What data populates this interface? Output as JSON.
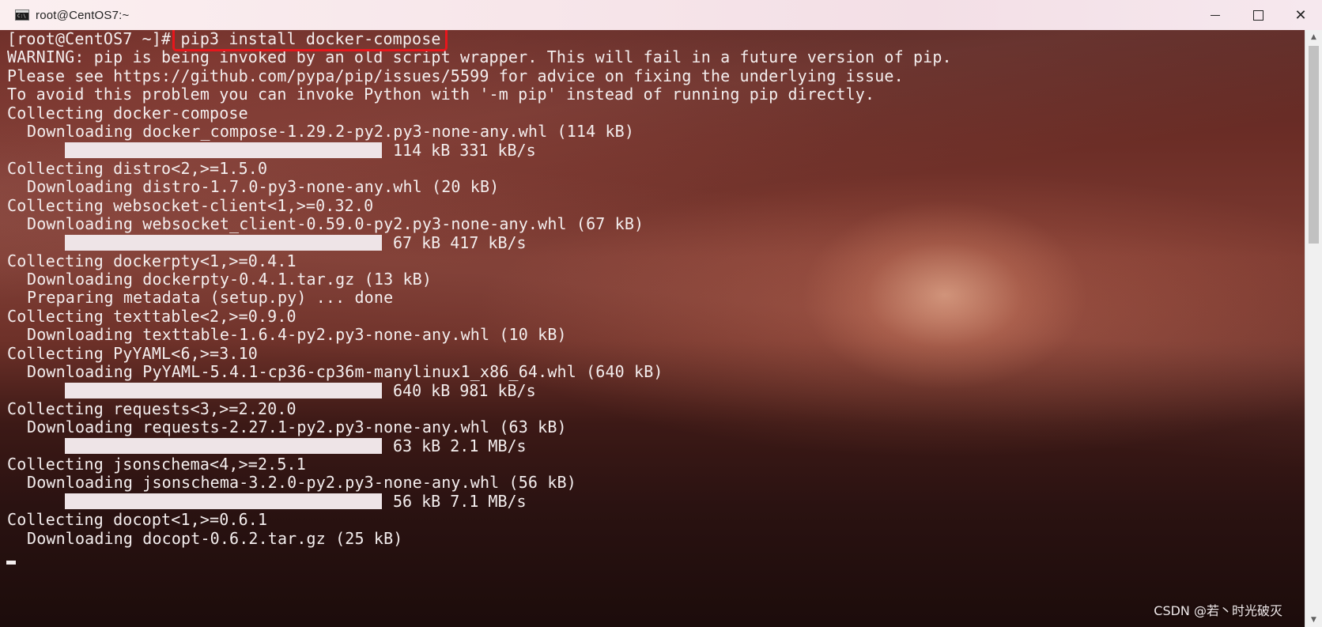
{
  "window": {
    "title": "root@CentOS7:~",
    "icon": "console-icon",
    "icon_text": "C:\\",
    "controls": {
      "minimize_icon": "minimize-icon",
      "maximize_icon": "maximize-icon",
      "close_icon": "close-icon",
      "close_glyph": "✕"
    }
  },
  "terminal": {
    "prompt_line": {
      "prompt": "[root@CentOS7 ~]# ",
      "command": "pip3 install docker-compose"
    },
    "lines": [
      {
        "kind": "text",
        "indent": false,
        "text": "WARNING: pip is being invoked by an old script wrapper. This will fail in a future version of pip."
      },
      {
        "kind": "text",
        "indent": false,
        "text": "Please see https://github.com/pypa/pip/issues/5599 for advice on fixing the underlying issue."
      },
      {
        "kind": "text",
        "indent": false,
        "text": "To avoid this problem you can invoke Python with '-m pip' instead of running pip directly."
      },
      {
        "kind": "text",
        "indent": false,
        "text": "Collecting docker-compose"
      },
      {
        "kind": "text",
        "indent": true,
        "text": "Downloading docker_compose-1.29.2-py2.py3-none-any.whl (114 kB)"
      },
      {
        "kind": "progress",
        "text": "114 kB 331 kB/s",
        "progress": 1.0
      },
      {
        "kind": "text",
        "indent": false,
        "text": "Collecting distro<2,>=1.5.0"
      },
      {
        "kind": "text",
        "indent": true,
        "text": "Downloading distro-1.7.0-py3-none-any.whl (20 kB)"
      },
      {
        "kind": "text",
        "indent": false,
        "text": "Collecting websocket-client<1,>=0.32.0"
      },
      {
        "kind": "text",
        "indent": true,
        "text": "Downloading websocket_client-0.59.0-py2.py3-none-any.whl (67 kB)"
      },
      {
        "kind": "progress",
        "text": "67 kB 417 kB/s",
        "progress": 1.0
      },
      {
        "kind": "text",
        "indent": false,
        "text": "Collecting dockerpty<1,>=0.4.1"
      },
      {
        "kind": "text",
        "indent": true,
        "text": "Downloading dockerpty-0.4.1.tar.gz (13 kB)"
      },
      {
        "kind": "text",
        "indent": true,
        "text": "Preparing metadata (setup.py) ... done"
      },
      {
        "kind": "text",
        "indent": false,
        "text": "Collecting texttable<2,>=0.9.0"
      },
      {
        "kind": "text",
        "indent": true,
        "text": "Downloading texttable-1.6.4-py2.py3-none-any.whl (10 kB)"
      },
      {
        "kind": "text",
        "indent": false,
        "text": "Collecting PyYAML<6,>=3.10"
      },
      {
        "kind": "text",
        "indent": true,
        "text": "Downloading PyYAML-5.4.1-cp36-cp36m-manylinux1_x86_64.whl (640 kB)"
      },
      {
        "kind": "progress",
        "text": "640 kB 981 kB/s",
        "progress": 1.0
      },
      {
        "kind": "text",
        "indent": false,
        "text": "Collecting requests<3,>=2.20.0"
      },
      {
        "kind": "text",
        "indent": true,
        "text": "Downloading requests-2.27.1-py2.py3-none-any.whl (63 kB)"
      },
      {
        "kind": "progress",
        "text": "63 kB 2.1 MB/s",
        "progress": 1.0
      },
      {
        "kind": "text",
        "indent": false,
        "text": "Collecting jsonschema<4,>=2.5.1"
      },
      {
        "kind": "text",
        "indent": true,
        "text": "Downloading jsonschema-3.2.0-py2.py3-none-any.whl (56 kB)"
      },
      {
        "kind": "progress",
        "text": "56 kB 7.1 MB/s",
        "progress": 1.0
      },
      {
        "kind": "text",
        "indent": false,
        "text": "Collecting docopt<1,>=0.6.1"
      },
      {
        "kind": "text",
        "indent": true,
        "text": "Downloading docopt-0.6.2.tar.gz (25 kB)"
      }
    ]
  },
  "scrollbar": {
    "up_glyph": "▲",
    "down_glyph": "▼"
  },
  "watermark": "CSDN @若丶时光破灭",
  "colors": {
    "terminal_text": "#f4eeee",
    "highlight_border": "#e8161c",
    "progress_bar": "#eee4e7",
    "titlebar": "#f7e6ea"
  }
}
